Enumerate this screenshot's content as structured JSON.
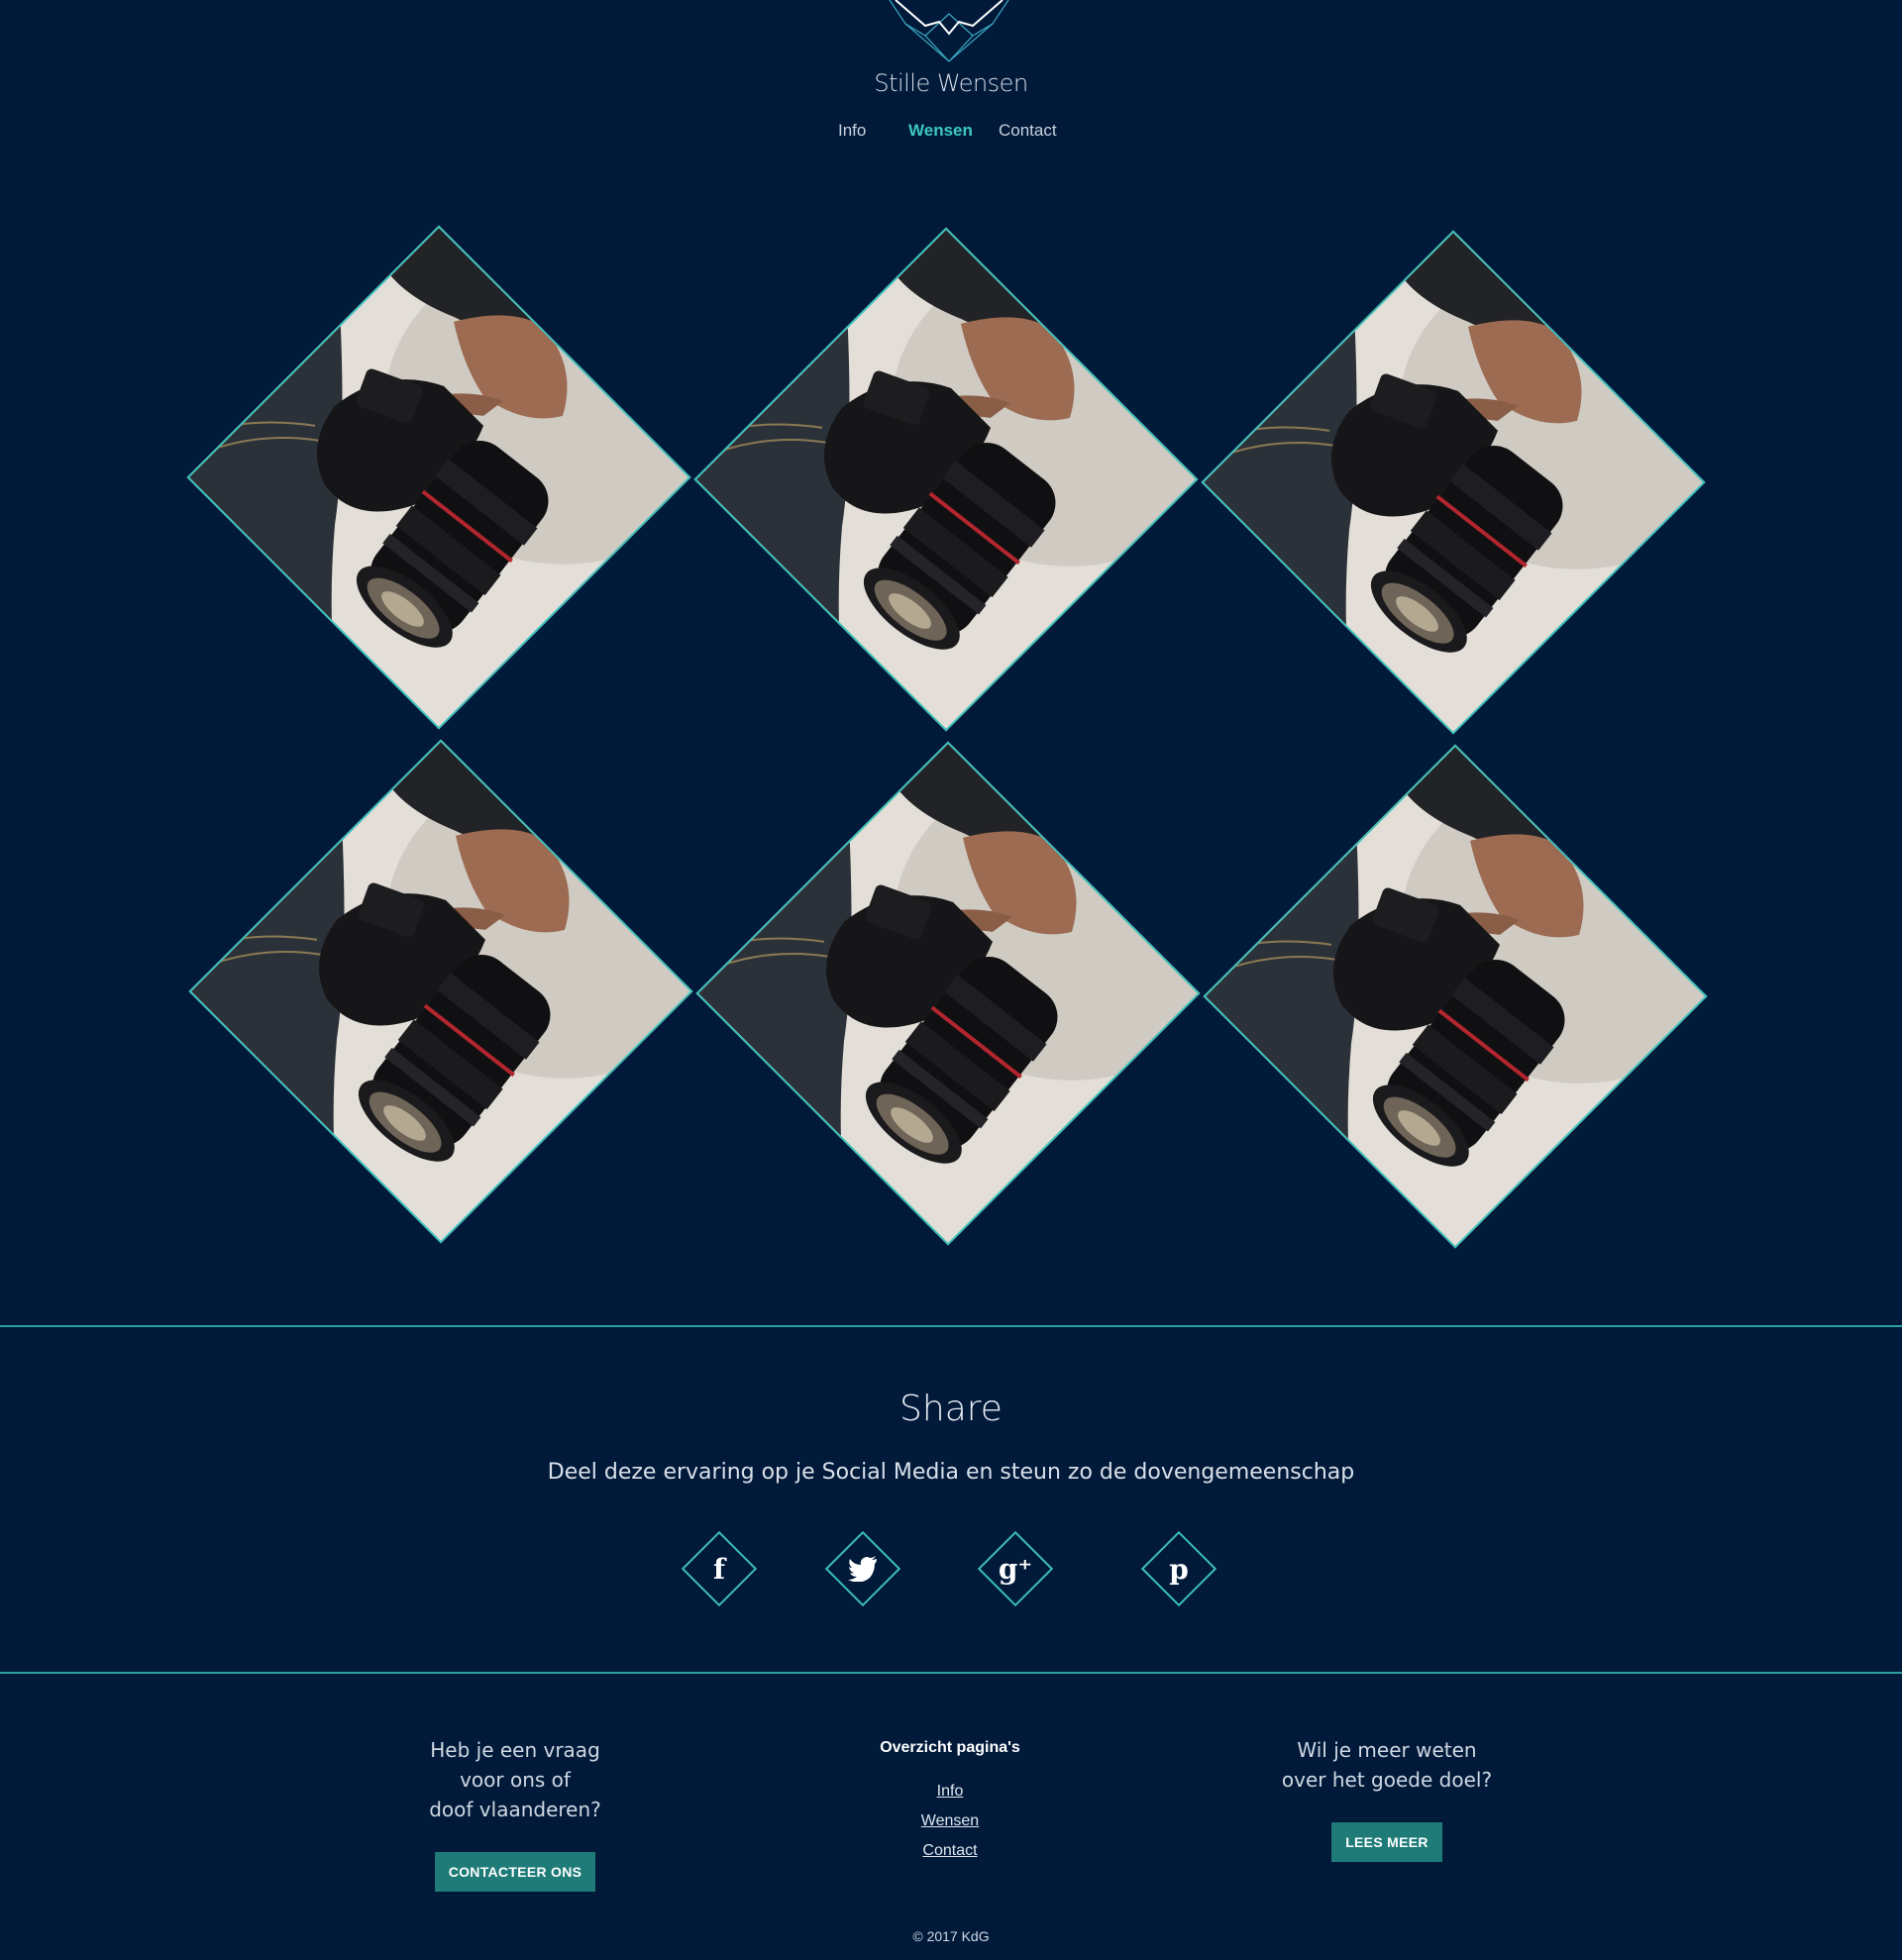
{
  "header": {
    "brand": "Stille Wensen",
    "nav": [
      {
        "label": "Info",
        "active": false
      },
      {
        "label": "Wensen",
        "active": true
      },
      {
        "label": "Contact",
        "active": false
      }
    ]
  },
  "gallery": {
    "items": [
      "camera-photo",
      "camera-photo",
      "camera-photo",
      "camera-photo",
      "camera-photo",
      "camera-photo"
    ]
  },
  "share": {
    "title": "Share",
    "subtitle": "Deel deze ervaring op je Social Media en steun zo de dovengemeenschap",
    "icons": [
      {
        "name": "facebook-icon",
        "glyph": "f"
      },
      {
        "name": "twitter-icon",
        "glyph": "🐦"
      },
      {
        "name": "google-plus-icon",
        "glyph": "g⁺"
      },
      {
        "name": "pinterest-icon",
        "glyph": "p"
      }
    ]
  },
  "footer": {
    "left": {
      "line1": "Heb je een vraag",
      "line2": "voor ons of",
      "line3": "doof vlaanderen?",
      "button": "CONTACTEER ONS"
    },
    "middle": {
      "title": "Overzicht pagina's",
      "links": [
        "Info",
        "Wensen",
        "Contact"
      ]
    },
    "right": {
      "line1": "Wil je meer weten",
      "line2": "over het goede doel?",
      "button": "LEES MEER"
    },
    "copyright": "© 2017 KdG"
  },
  "colors": {
    "background": "#011a3a",
    "accent": "#3bbfb8",
    "button": "#1f7b78"
  }
}
